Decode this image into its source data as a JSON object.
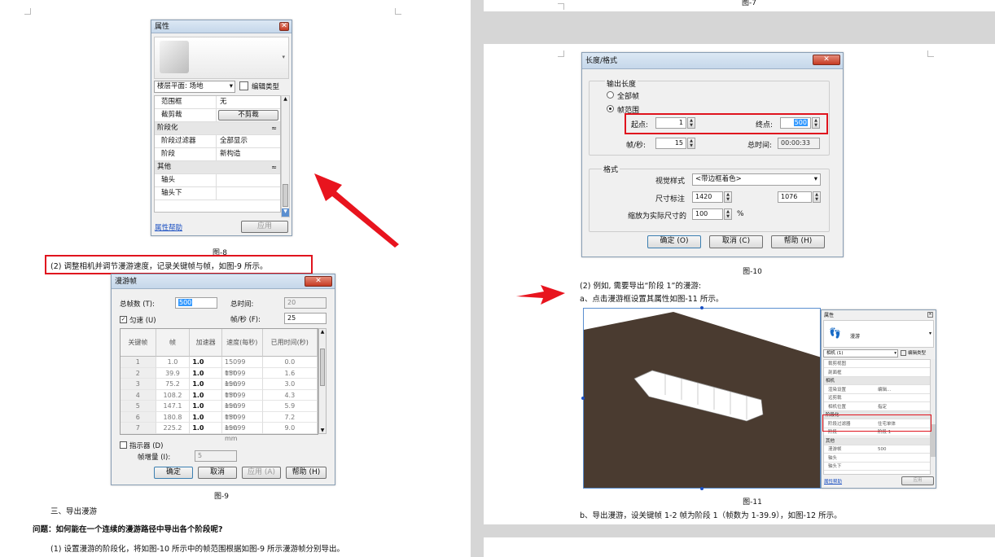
{
  "left_page": {
    "fig8": {
      "title": "属性",
      "view_select": "楼层平面: 场地",
      "edit_type": "编辑类型",
      "rows": [
        {
          "key": "范围框",
          "value": "无",
          "group": false
        },
        {
          "key": "截剪裁",
          "value": "不剪裁",
          "group": false,
          "button": true
        },
        {
          "key": "阶段化",
          "value": "",
          "group": true
        },
        {
          "key": "阶段过滤器",
          "value": "全部显示",
          "group": false
        },
        {
          "key": "阶段",
          "value": "新构造",
          "group": false
        },
        {
          "key": "其他",
          "value": "",
          "group": true
        },
        {
          "key": "轴头",
          "value": "",
          "group": false
        },
        {
          "key": "轴头下",
          "value": "",
          "group": false
        }
      ],
      "help_link": "属性帮助",
      "apply": "应用",
      "caption": "图-8"
    },
    "step2": "(2) 调整相机并调节漫游速度，记录关键帧与帧，如图-9 所示。",
    "fig9": {
      "title": "漫游帧",
      "total_frames_label": "总帧数 (T):",
      "total_frames": "500",
      "total_time_label": "总时间:",
      "total_time": "20",
      "uniform_label": "匀速 (U)",
      "fps_label": "帧/秒 (F):",
      "fps": "25",
      "columns": [
        "关键帧",
        "帧",
        "加速器",
        "速度(每秒)",
        "已用时间(秒)"
      ],
      "rows": [
        [
          "1",
          "1.0",
          "1.0",
          "15099 mm",
          "0.0"
        ],
        [
          "2",
          "39.9",
          "1.0",
          "15099 mm",
          "1.6"
        ],
        [
          "3",
          "75.2",
          "1.0",
          "15099 mm",
          "3.0"
        ],
        [
          "4",
          "108.2",
          "1.0",
          "15099 mm",
          "4.3"
        ],
        [
          "5",
          "147.1",
          "1.0",
          "15099 mm",
          "5.9"
        ],
        [
          "6",
          "180.8",
          "1.0",
          "15099 mm",
          "7.2"
        ],
        [
          "7",
          "225.2",
          "1.0",
          "15099 mm",
          "9.0"
        ]
      ],
      "indicator_label": "指示器 (D)",
      "frame_inc_label": "帧增量 (I):",
      "frame_inc": "5",
      "ok": "确定",
      "cancel": "取消",
      "apply": "应用 (A)",
      "help": "帮助 (H)",
      "caption": "图-9"
    },
    "section3": "三、导出漫游",
    "question": "问题：如何能在一个连续的漫游路径中导出各个阶段呢?",
    "step1": "(1) 设置漫游的阶段化，将如图-10 所示中的帧范围根据如图-9 所示漫游帧分别导出。"
  },
  "right_page": {
    "top_caption": "图-7",
    "fig10": {
      "title": "长度/格式",
      "output_length": "输出长度",
      "all_frames": "全部帧",
      "frame_range": "帧范围",
      "start_label": "起点:",
      "start": "1",
      "end_label": "终点:",
      "end": "500",
      "fps_label": "帧/秒:",
      "fps": "15",
      "total_time_label": "总时间:",
      "total_time": "00:00:33",
      "format": "格式",
      "visual_style_label": "视觉样式",
      "visual_style": "<带边框着色>",
      "size_label": "尺寸标注",
      "width": "1420",
      "height": "1076",
      "zoom_label": "缩放为实际尺寸的",
      "zoom": "100",
      "zoom_unit": "%",
      "ok": "确定 (O)",
      "cancel": "取消 (C)",
      "help": "帮助 (H)",
      "caption": "图-10"
    },
    "step2": "(2) 例如, 需要导出“阶段 1”的漫游:",
    "step_a": "a、点击漫游框设置其属性如图-11 所示。",
    "fig11": {
      "panel_title": "属性",
      "type_name": "漫游",
      "selector": "相机 (1)",
      "edit_type": "编辑类型",
      "rows": [
        {
          "key": "裁剪视图",
          "value": "",
          "group": false
        },
        {
          "key": "剖面框",
          "value": "",
          "group": false
        },
        {
          "key": "相机",
          "value": "",
          "group": true
        },
        {
          "key": "渲染设置",
          "value": "编辑...",
          "group": false
        },
        {
          "key": "远剪裁",
          "value": "",
          "group": false
        },
        {
          "key": "相机位置",
          "value": "指定",
          "group": false
        },
        {
          "key": "阶段化",
          "value": "",
          "group": true
        },
        {
          "key": "阶段过滤器",
          "value": "住宅单体",
          "group": false
        },
        {
          "key": "阶段",
          "value": "阶段 1",
          "group": false
        },
        {
          "key": "其他",
          "value": "",
          "group": true
        },
        {
          "key": "漫游帧",
          "value": "500",
          "group": false
        },
        {
          "key": "轴头",
          "value": "",
          "group": false
        },
        {
          "key": "轴头下",
          "value": "",
          "group": false
        }
      ],
      "help_link": "属性帮助",
      "apply": "应用",
      "caption": "图-11"
    },
    "step_b": "b、导出漫游，设关键帧 1-2 帧为阶段 1（帧数为 1-39.9），如图-12 所示。"
  },
  "colors": {
    "highlight": "#e0141e",
    "arrow": "#e8141e",
    "floor": "#4a3b30"
  }
}
